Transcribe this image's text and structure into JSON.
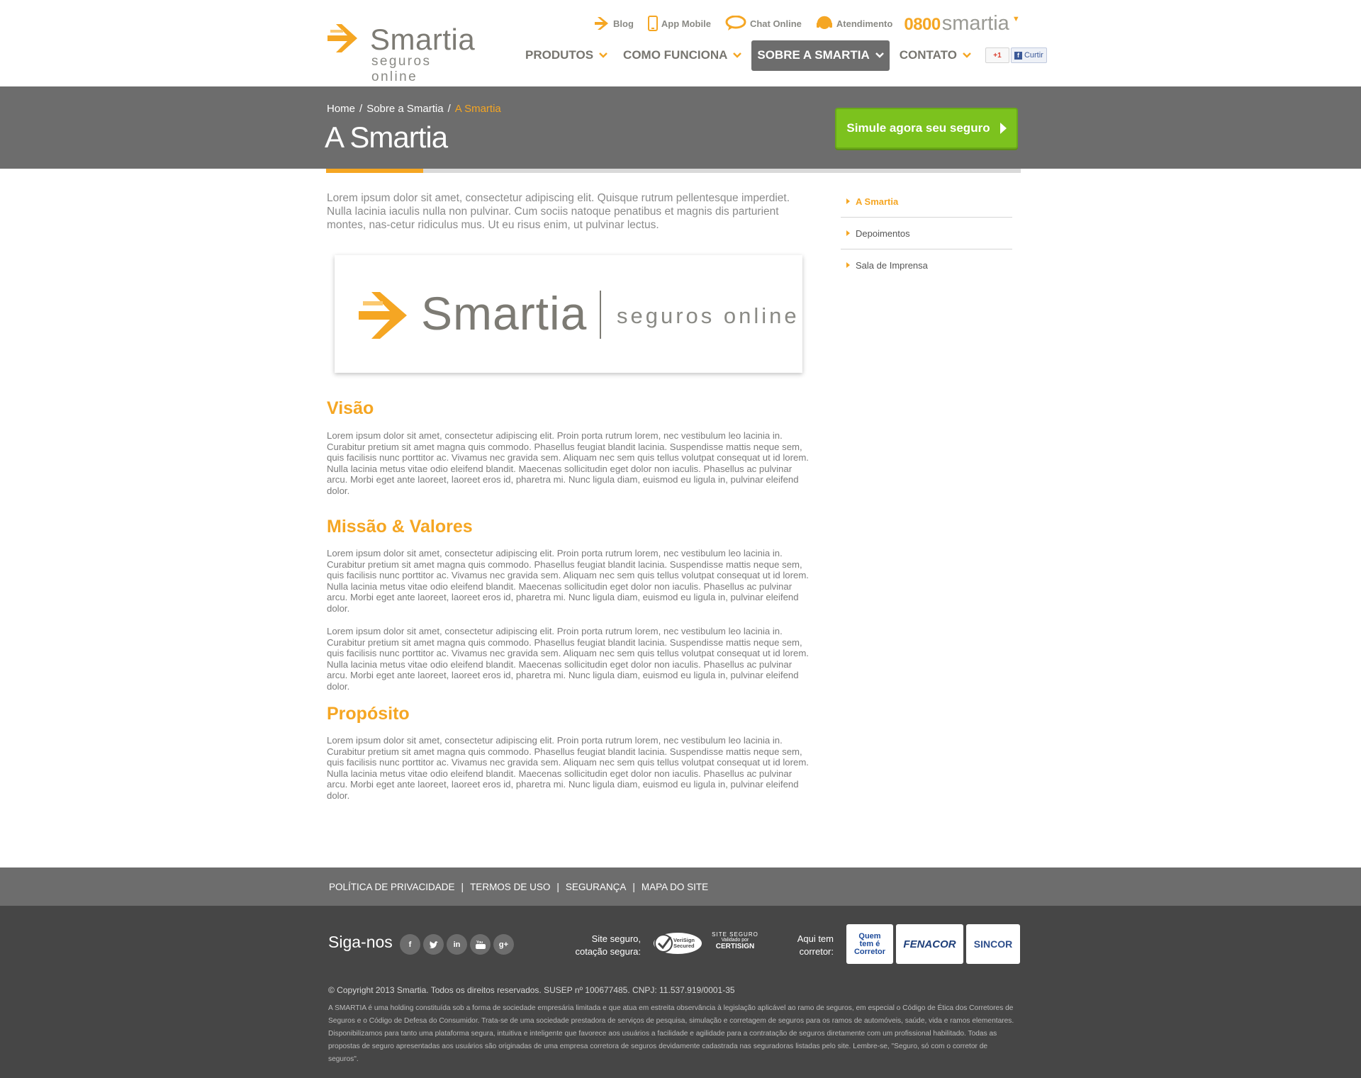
{
  "brand": {
    "name": "Smartia",
    "tagline": "seguros online",
    "accent": "#f5a623",
    "green": "#7cc21e",
    "gray": "#6d6d6d"
  },
  "utility_nav": {
    "items": [
      {
        "label": "Blog",
        "icon": "arrow-icon"
      },
      {
        "label": "App Mobile",
        "icon": "phone-icon"
      },
      {
        "label": "Chat Online",
        "icon": "chat-icon"
      },
      {
        "label": "Atendimento",
        "icon": "headset-icon"
      }
    ],
    "phone_prefix": "0800",
    "phone_brand": "smartia"
  },
  "main_nav": {
    "items": [
      {
        "label": "PRODUTOS"
      },
      {
        "label": "COMO FUNCIONA"
      },
      {
        "label": "SOBRE A SMARTIA",
        "active": true
      },
      {
        "label": "CONTATO"
      }
    ],
    "gplus_label": "+1",
    "fb_label": "Curtir"
  },
  "breadcrumb": {
    "items": [
      "Home",
      "Sobre a Smartia"
    ],
    "current": "A Smartia"
  },
  "page_title": "A Smartia",
  "cta_label": "Simule agora seu seguro",
  "section_progress": 0.14,
  "intro": "Lorem ipsum dolor sit amet, consectetur adipiscing elit. Quisque rutrum pellentesque imperdiet. Nulla lacinia iaculis nulla non pulvinar. Cum sociis natoque penatibus et magnis dis parturient montes, nas-cetur ridiculus mus. Ut eu risus enim, ut pulvinar lectus.",
  "sections": {
    "visao": {
      "title": "Visão",
      "p1": "Lorem ipsum dolor sit amet, consectetur adipiscing elit. Proin porta rutrum lorem, nec vestibulum leo lacinia in. Curabitur pretium sit amet magna quis commodo. Phasellus feugiat blandit lacinia. Suspendisse mattis neque sem, quis facilisis nunc porttitor ac. Vivamus nec gravida sem. Aliquam nec sem quis tellus volutpat consequat ut id lorem. Nulla lacinia metus vitae odio eleifend blandit. Maecenas sollicitudin eget dolor non iaculis. Phasellus ac pulvinar arcu. Morbi eget ante laoreet, laoreet eros id, pharetra mi. Nunc ligula diam, euismod eu ligula in, pulvinar eleifend dolor."
    },
    "missao": {
      "title": "Missão & Valores",
      "p1": "Lorem ipsum dolor sit amet, consectetur adipiscing elit. Proin porta rutrum lorem, nec vestibulum leo lacinia in. Curabitur pretium sit amet magna quis commodo. Phasellus feugiat blandit lacinia. Suspendisse mattis neque sem, quis facilisis nunc porttitor ac. Vivamus nec gravida sem. Aliquam nec sem quis tellus volutpat consequat ut id lorem. Nulla lacinia metus vitae odio eleifend blandit. Maecenas sollicitudin eget dolor non iaculis. Phasellus ac pulvinar arcu. Morbi eget ante laoreet, laoreet eros id, pharetra mi. Nunc ligula diam, euismod eu ligula in, pulvinar eleifend dolor.",
      "p2": "Lorem ipsum dolor sit amet, consectetur adipiscing elit. Proin porta rutrum lorem, nec vestibulum leo lacinia in. Curabitur pretium sit amet magna quis commodo. Phasellus feugiat blandit lacinia. Suspendisse mattis neque sem, quis facilisis nunc porttitor ac. Vivamus nec gravida sem. Aliquam nec sem quis tellus volutpat consequat ut id lorem. Nulla lacinia metus vitae odio eleifend blandit. Maecenas sollicitudin eget dolor non iaculis. Phasellus ac pulvinar arcu. Morbi eget ante laoreet, laoreet eros id, pharetra mi. Nunc ligula diam, euismod eu ligula in, pulvinar eleifend dolor."
    },
    "proposito": {
      "title": "Propósito",
      "p1": "Lorem ipsum dolor sit amet, consectetur adipiscing elit. Proin porta rutrum lorem, nec vestibulum leo lacinia in. Curabitur pretium sit amet magna quis commodo. Phasellus feugiat blandit lacinia. Suspendisse mattis neque sem, quis facilisis nunc porttitor ac. Vivamus nec gravida sem. Aliquam nec sem quis tellus volutpat consequat ut id lorem. Nulla lacinia metus vitae odio eleifend blandit. Maecenas sollicitudin eget dolor non iaculis. Phasellus ac pulvinar arcu. Morbi eget ante laoreet, laoreet eros id, pharetra mi. Nunc ligula diam, euismod eu ligula in, pulvinar eleifend dolor."
    }
  },
  "sidebar": {
    "items": [
      {
        "label": "A Smartia",
        "active": true
      },
      {
        "label": "Depoimentos"
      },
      {
        "label": "Sala de Imprensa"
      }
    ]
  },
  "footer_links": [
    "POLÍTICA DE PRIVACIDADE",
    "TERMOS DE USO",
    "SEGURANÇA",
    "MAPA DO SITE"
  ],
  "footer": {
    "follow_label": "Siga-nos",
    "social": [
      "facebook-icon",
      "twitter-icon",
      "linkedin-icon",
      "youtube-icon",
      "googleplus-icon"
    ],
    "secure_line1": "Site seguro,",
    "secure_line2": "cotação segura:",
    "seal_verisign": "VeriSign Secured",
    "seal_certisign_top": "SITE SEGURO",
    "seal_certisign_mid": "Validado por",
    "seal_certisign_bottom": "CERTISIGN",
    "broker_line1": "Aqui tem",
    "broker_line2": "corretor:",
    "brokers": [
      "Quem tem é Corretor",
      "FENACOR",
      "SINCOR"
    ],
    "copyright": "© Copyright 2013 Smartia. Todos os direitos reservados. SUSEP nº 100677485. CNPJ: 11.537.919/0001-35",
    "legal": "A SMARTIA é uma holding constituída sob a forma de sociedade empresária limitada e que atua em estreita observância à legislação aplicável ao ramo de seguros, em especial o Código de Ética dos Corretores de Seguros e o Código de Defesa do Consumidor. Trata-se de uma sociedade prestadora de serviços de pesquisa, simulação e corretagem de seguros para os ramos de automóveis, saúde, vida e ramos elementares. Disponibilizamos para tanto uma plataforma segura, intuitiva e inteligente que favorece aos usuários a facilidade e agilidade para a contratação de seguros diretamente com um profissional habilitado. Todas as propostas de seguro apresentadas aos usuários são originadas de uma empresa corretora de seguros devidamente cadastrada nas seguradoras listadas pelo site. Lembre-se, \"Seguro, só com o corretor de seguros\"."
  }
}
